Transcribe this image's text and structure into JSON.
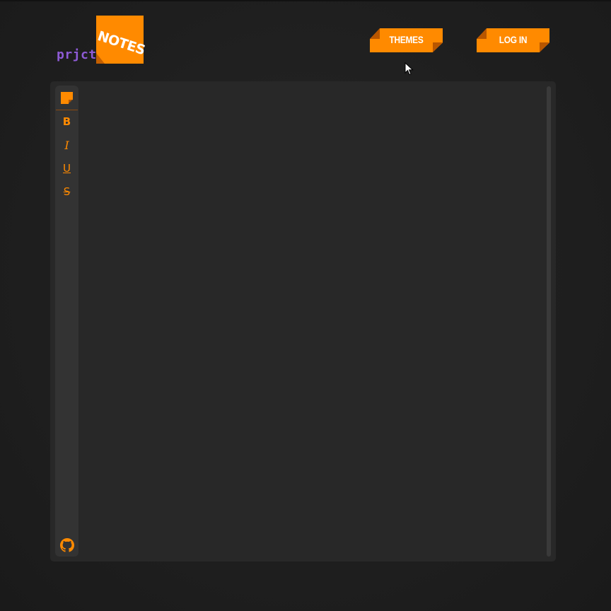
{
  "logo": {
    "notes_text": "NOTES",
    "prjct_text": "prjct"
  },
  "header": {
    "themes_label": "THEMES",
    "login_label": "LOG IN"
  },
  "toolbar": {
    "note_icon": "sticky-note-icon",
    "bold_label": "B",
    "italic_label": "I",
    "underline_label": "U",
    "strike_label": "S",
    "github_icon": "github-icon"
  },
  "colors": {
    "accent": "#ff8a00",
    "accent_dark": "#b85600",
    "logo_purple": "#8e5bd6",
    "background": "#1e1e1e",
    "panel": "#282828",
    "toolbar": "#333333"
  }
}
